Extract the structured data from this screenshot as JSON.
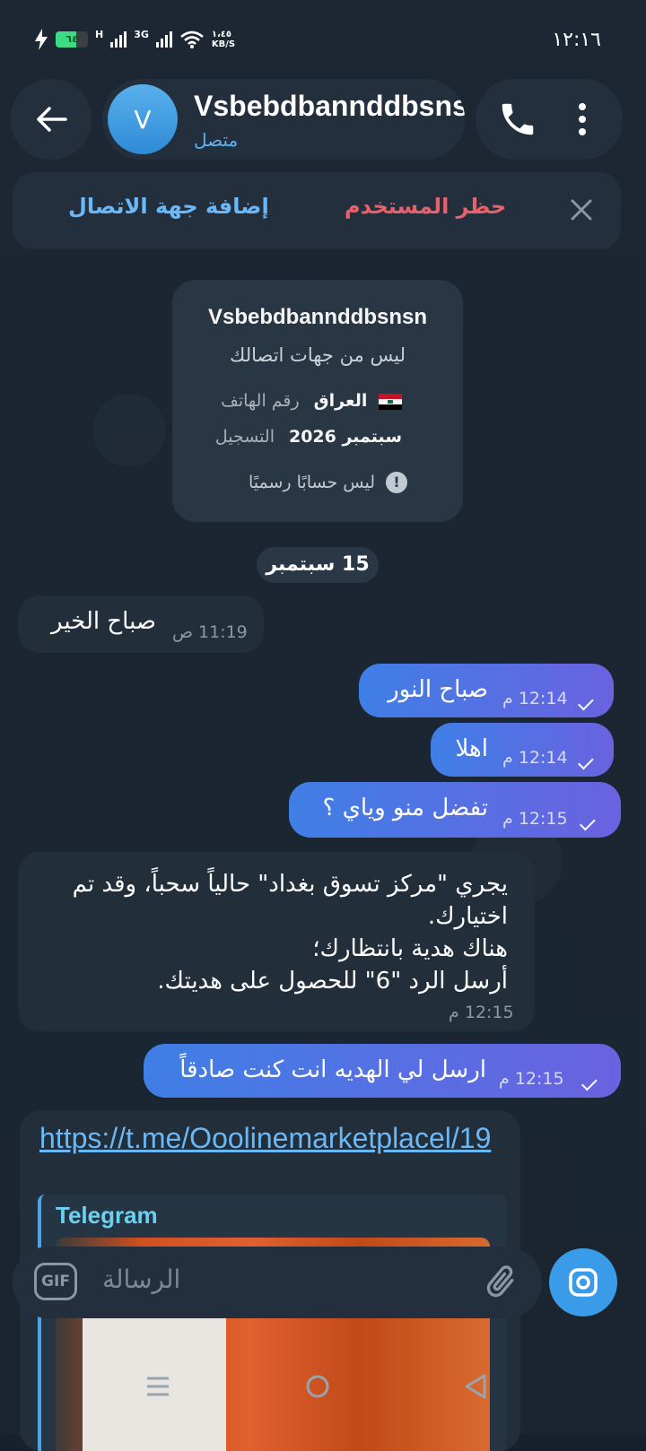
{
  "status_bar": {
    "battery": "٦٤",
    "battery_level": 0.64,
    "net1": "H",
    "net2": "3G",
    "speed_value": "١،٤٥",
    "speed_unit": "KB/S",
    "time": "١٢:١٦"
  },
  "header": {
    "avatar_letter": "V",
    "name": "Vsbebdbannddbsnsn",
    "status": "متصل"
  },
  "banner": {
    "add_contact": "إضافة جهة الاتصال",
    "block_user": "حظر المستخدم"
  },
  "info_card": {
    "name": "Vsbebdbannddbsnsn",
    "subtitle": "ليس من جهات اتصالك",
    "phone_label": "رقم الهاتف",
    "phone_value": "العراق",
    "reg_label": "التسجيل",
    "reg_value": "سبتمبر 2026",
    "warning": "ليس حسابًا رسميًا"
  },
  "date_chip": "15 سبتمبر",
  "messages": [
    {
      "direction": "in",
      "text": "صباح الخير",
      "time": "11:19 ص"
    },
    {
      "direction": "out",
      "text": "صباح النور",
      "time": "12:14 م"
    },
    {
      "direction": "out",
      "text": "اهلا",
      "time": "12:14 م"
    },
    {
      "direction": "out",
      "text": "تفضل منو وياي ؟",
      "time": "12:15 م"
    },
    {
      "direction": "in",
      "lines": [
        "يجري \"مركز تسوق بغداد\" حالياً سحباً، وقد تم اختيارك.",
        "هناك هدية بانتظارك؛",
        "أرسل الرد \"6\" للحصول على هديتك."
      ],
      "time": "12:15 م"
    },
    {
      "direction": "out",
      "text": "ارسل لي الهديه انت كنت صادقاً",
      "time": "12:15 م"
    }
  ],
  "link_message": {
    "url": "https://t.me/Ooolinemarketplacel/19",
    "preview_site": "Telegram"
  },
  "input": {
    "gif_label": "GIF",
    "placeholder": "الرسالة"
  }
}
